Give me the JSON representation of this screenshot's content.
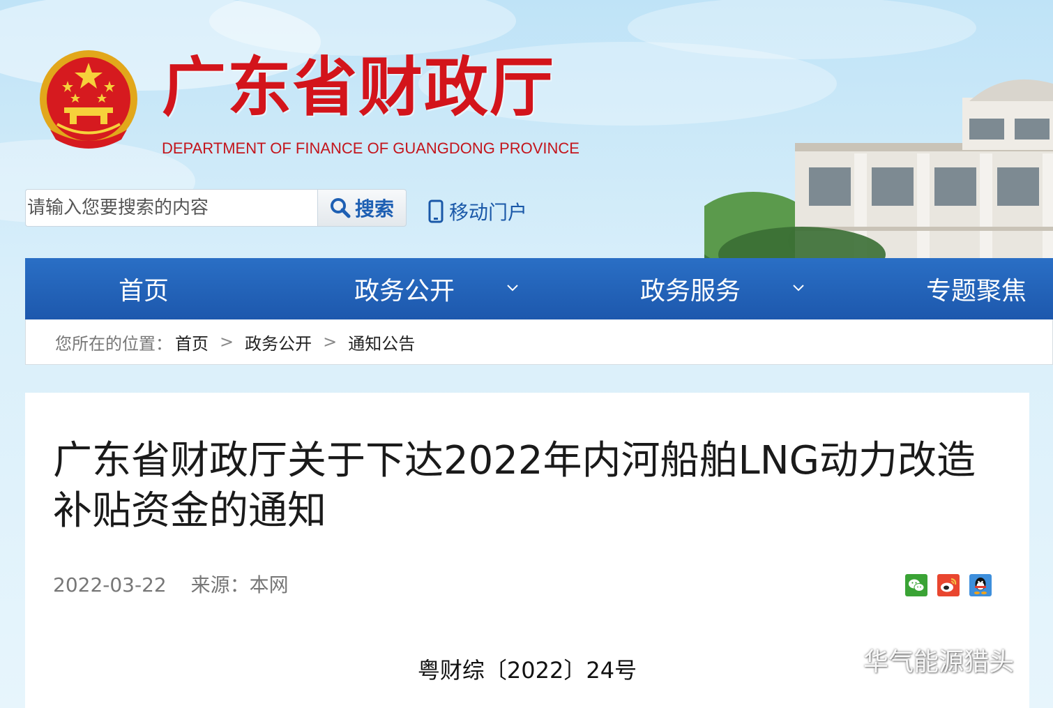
{
  "header": {
    "title": "广东省财政厅",
    "subtitle": "DEPARTMENT OF FINANCE OF GUANGDONG PROVINCE",
    "emblem_icon": "national-emblem-icon",
    "title_color": "#d3141b"
  },
  "search": {
    "placeholder": "请输入您要搜索的内容",
    "button_label": "搜索",
    "button_icon": "search-icon"
  },
  "mobile": {
    "label": "移动门户",
    "icon": "mobile-phone-icon"
  },
  "nav": {
    "items": [
      {
        "label": "首页"
      },
      {
        "label": "政务公开",
        "has_dropdown": true
      },
      {
        "label": "政务服务",
        "has_dropdown": true
      },
      {
        "label": "专题聚焦"
      }
    ],
    "bg_color": "#2363b8"
  },
  "breadcrumb": {
    "prefix": "您所在的位置：",
    "items": [
      "首页",
      "政务公开",
      "通知公告"
    ],
    "separator": ">"
  },
  "article": {
    "title": "广东省财政厅关于下达2022年内河船舶LNG动力改造补贴资金的通知",
    "date": "2022-03-22",
    "source": "来源：本网",
    "doc_number": "粤财综〔2022〕24号",
    "share": [
      "wechat-icon",
      "weibo-icon",
      "qq-icon"
    ]
  },
  "watermark": {
    "text": "华气能源猎头",
    "icon": "wechat-icon"
  }
}
